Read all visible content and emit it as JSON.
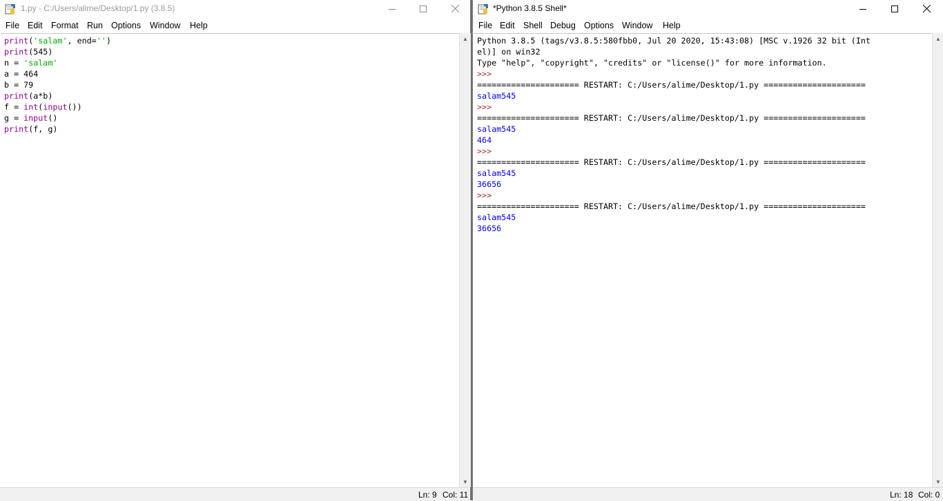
{
  "editor_window": {
    "title": "1.py - C:/Users/alime/Desktop/1.py (3.8.5)",
    "menu": [
      "File",
      "Edit",
      "Format",
      "Run",
      "Options",
      "Window",
      "Help"
    ],
    "status": {
      "line": "Ln: 9",
      "col": "Col: 11"
    }
  },
  "shell_window": {
    "title": "*Python 3.8.5 Shell*",
    "menu": [
      "File",
      "Edit",
      "Shell",
      "Debug",
      "Options",
      "Window",
      "Help"
    ],
    "status": {
      "line": "Ln: 18",
      "col": "Col: 0"
    }
  },
  "code": {
    "l1": {
      "kw": "print",
      "a": "(",
      "s1": "'salam'",
      "b": ", end=",
      "s2": "''",
      "c": ")"
    },
    "l2": {
      "kw": "print",
      "a": "(545)"
    },
    "l3": {
      "a": "n = ",
      "s": "'salam'"
    },
    "l4": "a = 464",
    "l5": "b = 79",
    "l6": {
      "kw": "print",
      "a": "(a*b)"
    },
    "l7": {
      "a": "f = ",
      "kw1": "int",
      "b": "(",
      "kw2": "input",
      "c": "())"
    },
    "l8": {
      "a": "g = ",
      "kw": "input",
      "b": "()"
    },
    "l9": {
      "kw": "print",
      "a": "(f, g)"
    }
  },
  "shell": {
    "banner1": "Python 3.8.5 (tags/v3.8.5:580fbb0, Jul 20 2020, 15:43:08) [MSC v.1926 32 bit (Int",
    "banner2": "el)] on win32",
    "banner3": "Type \"help\", \"copyright\", \"credits\" or \"license()\" for more information.",
    "prompt": ">>>",
    "restart": "===================== RESTART: C:/Users/alime/Desktop/1.py =====================",
    "out_salam": "salam545",
    "out_464": "464",
    "out_36656": "36656"
  },
  "icons": {
    "app": "python-idle-icon",
    "minimize": "minimize-icon",
    "maximize": "maximize-icon",
    "close": "close-icon"
  },
  "colors": {
    "keyword": "#900090",
    "string": "#00aa00",
    "output": "#0000ff",
    "prompt": "#a52a2a"
  }
}
